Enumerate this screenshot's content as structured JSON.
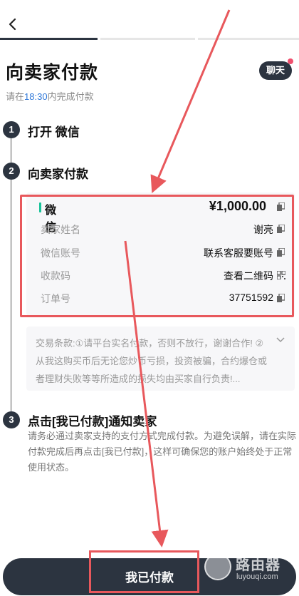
{
  "header": {
    "back_icon": "chevron-left-icon"
  },
  "page": {
    "title": "向卖家付款",
    "chat_label": "聊天",
    "deadline_prefix": "请在",
    "deadline_time": "18:30",
    "deadline_suffix": "内完成付款"
  },
  "steps": [
    {
      "number": "1",
      "title": "打开 微信"
    },
    {
      "number": "2",
      "title": "向卖家付款"
    },
    {
      "number": "3",
      "title": "点击[我已付款]通知卖家"
    }
  ],
  "payment": {
    "method": "微信",
    "amount": "¥1,000.00",
    "rows": [
      {
        "label": "卖家姓名",
        "value": "谢亮",
        "icon": "copy-icon"
      },
      {
        "label": "微信账号",
        "value": "联系客服要账号",
        "icon": "copy-icon"
      },
      {
        "label": "收款码",
        "value": "查看二维码",
        "icon": "qr-code-icon"
      },
      {
        "label": "订单号",
        "value": "37751592",
        "icon": "copy-icon"
      }
    ]
  },
  "terms": {
    "text": "交易条款:①请平台实名付款，否则不放行，谢谢合作! ②从我这购买币后无论您炒币亏损，投资被骗，合约爆仓或者理财失败等等所造成的损失均由买家自行负责!..."
  },
  "step3": {
    "description": "请务必通过卖家支持的支付方式完成付款。为避免误解，请在实际付款完成后再点击[我已付款]，这样可确保您的账户始终处于正常使用状态。"
  },
  "footer": {
    "pay_button_label": "我已付款"
  },
  "watermark": {
    "text": "路由器",
    "url": "luyouqi.com"
  },
  "colors": {
    "primary_dark": "#2c3440",
    "accent_blue": "#2f78d8",
    "wechat_green": "#19c39a",
    "annotation_red": "#e8585c"
  }
}
